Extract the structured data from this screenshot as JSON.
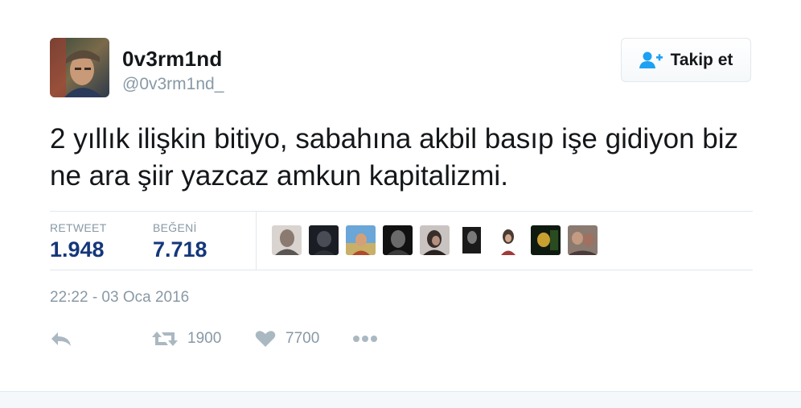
{
  "user": {
    "display_name": "0v3rm1nd",
    "screen_name": "@0v3rm1nd_",
    "avatar_icon": "user-avatar-photo"
  },
  "follow_button": {
    "label": "Takip et",
    "icon": "add-user-icon",
    "icon_color": "#1da1f2"
  },
  "tweet": {
    "text": "2 yıllık ilişkin bitiyo, sabahına akbil basıp işe gidiyon biz ne ara şiir yazcaz amkun kapitalizmi."
  },
  "stats": {
    "retweet_label": "RETWEET",
    "retweet_value": "1.948",
    "like_label": "BEĞENİ",
    "like_value": "7.718",
    "value_color": "#14377a"
  },
  "likers": [
    {
      "icon": "liker-avatar-1"
    },
    {
      "icon": "liker-avatar-2"
    },
    {
      "icon": "liker-avatar-3"
    },
    {
      "icon": "liker-avatar-4"
    },
    {
      "icon": "liker-avatar-5"
    },
    {
      "icon": "liker-avatar-6"
    },
    {
      "icon": "liker-avatar-7"
    },
    {
      "icon": "liker-avatar-8"
    },
    {
      "icon": "liker-avatar-9"
    }
  ],
  "timestamp": "22:22 - 03 Oca 2016",
  "actions": {
    "reply_icon": "reply-icon",
    "retweet_icon": "retweet-icon",
    "retweet_count": "1900",
    "like_icon": "heart-icon",
    "like_count": "7700",
    "more_icon": "more-dots-icon",
    "icon_color": "#aab8c2"
  }
}
